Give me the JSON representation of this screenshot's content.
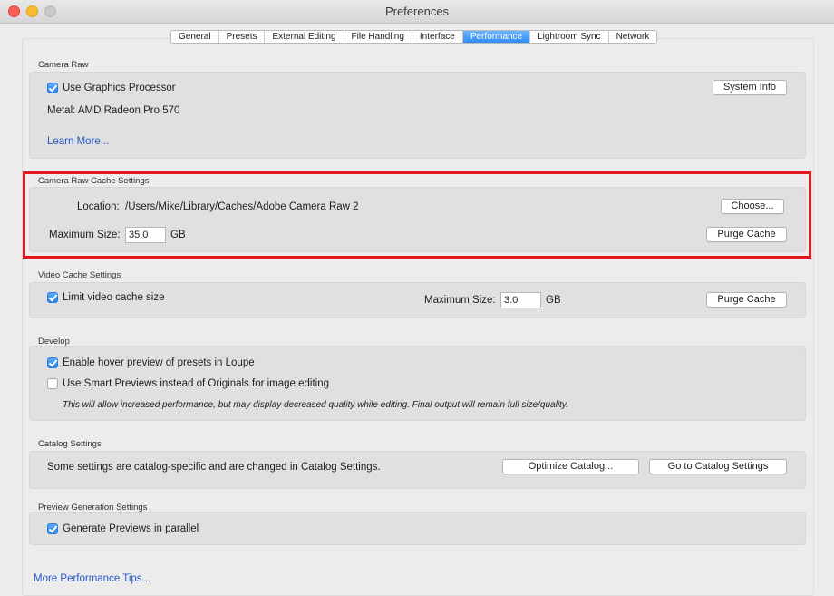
{
  "window": {
    "title": "Preferences"
  },
  "tabs": [
    {
      "label": "General",
      "active": false
    },
    {
      "label": "Presets",
      "active": false
    },
    {
      "label": "External Editing",
      "active": false
    },
    {
      "label": "File Handling",
      "active": false
    },
    {
      "label": "Interface",
      "active": false
    },
    {
      "label": "Performance",
      "active": true
    },
    {
      "label": "Lightroom Sync",
      "active": false
    },
    {
      "label": "Network",
      "active": false
    }
  ],
  "camera_raw": {
    "section_label": "Camera Raw",
    "use_gpu_label": "Use Graphics Processor",
    "use_gpu_checked": true,
    "system_info_button": "System Info",
    "metal_text": "Metal: AMD Radeon Pro 570",
    "learn_more_link": "Learn More..."
  },
  "camera_raw_cache": {
    "section_label": "Camera Raw Cache Settings",
    "location_label": "Location:",
    "location_path": "/Users/Mike/Library/Caches/Adobe Camera Raw 2",
    "choose_button": "Choose...",
    "max_size_label": "Maximum Size:",
    "max_size_value": "35.0",
    "unit": "GB",
    "purge_button": "Purge Cache"
  },
  "video_cache": {
    "section_label": "Video Cache Settings",
    "limit_label": "Limit video cache size",
    "limit_checked": true,
    "max_size_label": "Maximum Size:",
    "max_size_value": "3.0",
    "unit": "GB",
    "purge_button": "Purge Cache"
  },
  "develop": {
    "section_label": "Develop",
    "hover_preview_label": "Enable hover preview of presets in Loupe",
    "hover_preview_checked": true,
    "smart_previews_label": "Use Smart Previews instead of Originals for image editing",
    "smart_previews_checked": false,
    "note": "This will allow increased performance, but may display decreased quality while editing. Final output will remain full size/quality."
  },
  "catalog": {
    "section_label": "Catalog Settings",
    "description": "Some settings are catalog-specific and are changed in Catalog Settings.",
    "optimize_button": "Optimize Catalog...",
    "goto_button": "Go to Catalog Settings"
  },
  "preview_generation": {
    "section_label": "Preview Generation Settings",
    "parallel_label": "Generate Previews in parallel",
    "parallel_checked": true
  },
  "footer": {
    "tips_link": "More Performance Tips..."
  },
  "colors": {
    "accent": "#2f8cf4",
    "link": "#2757c7",
    "highlight_border": "#e3161b"
  }
}
